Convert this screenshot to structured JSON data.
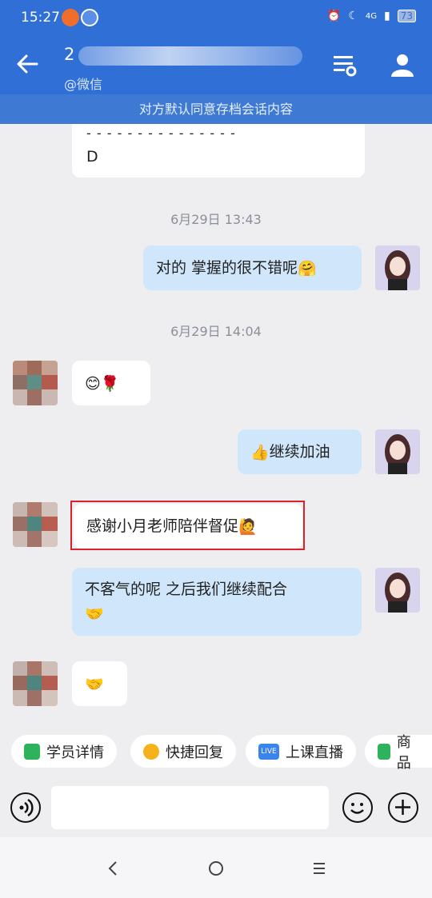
{
  "status_bar": {
    "time": "15:27",
    "network": "4G",
    "battery": "73"
  },
  "header": {
    "contact_name": "2",
    "sub_label": "@微信"
  },
  "notice": "对方默认同意存档会话内容",
  "chat": {
    "top_fragment": {
      "dashes": "- - - - - - - - - - - - - - -",
      "letter": "D"
    },
    "messages": [
      {
        "type": "timestamp",
        "text": "6月29日  13:43"
      },
      {
        "type": "self",
        "text": "对的 掌握的很不错呢",
        "emoji": "🤗"
      },
      {
        "type": "timestamp",
        "text": "6月29日  14:04"
      },
      {
        "type": "other",
        "emoji": "😊🌹"
      },
      {
        "type": "self",
        "emoji": "👍",
        "text": "继续加油"
      },
      {
        "type": "other",
        "text": "感谢小月老师陪伴督促",
        "emoji": "🙋",
        "highlighted": true
      },
      {
        "type": "self",
        "text": "不客气的呢 之后我们继续配合",
        "emoji": "🤝"
      },
      {
        "type": "other",
        "emoji": "🤝"
      }
    ]
  },
  "quick_actions": [
    {
      "label": "学员详情",
      "color": "#2db35b"
    },
    {
      "label": "快捷回复",
      "color": "#f6b21b"
    },
    {
      "label": "上课直播",
      "color": "#3a84f0",
      "icon_text": "LIVE"
    },
    {
      "label": "商品",
      "color": "#2db35b"
    }
  ],
  "input": {
    "placeholder": ""
  },
  "colors": {
    "header": "#2f6fd6",
    "notice": "#3e7ad3",
    "self_bubble": "#cfe6fb",
    "highlight": "#d8232a"
  }
}
